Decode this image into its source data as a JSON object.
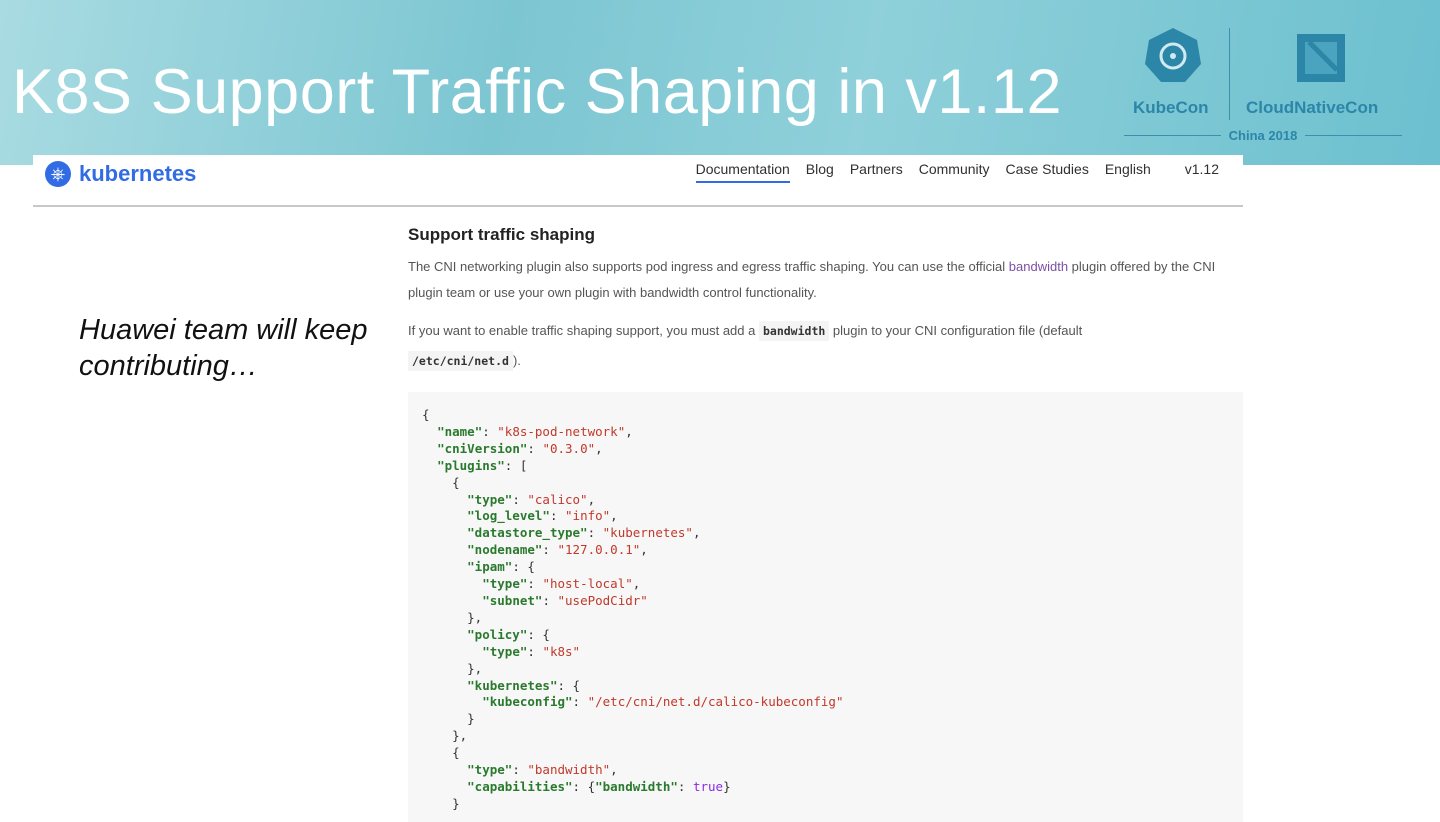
{
  "slide": {
    "title": "K8S Support Traffic Shaping in v1.12",
    "quote_line1": "Huawei team will keep",
    "quote_line2": "contributing…"
  },
  "branding": {
    "kubecon": "KubeCon",
    "cloudnativecon": "CloudNativeCon",
    "event": "China 2018"
  },
  "site": {
    "logo": "kubernetes",
    "nav": [
      "Documentation",
      "Blog",
      "Partners",
      "Community",
      "Case Studies",
      "English",
      "v1.12"
    ],
    "active_nav": "Documentation"
  },
  "article": {
    "heading": "Support traffic shaping",
    "p1_before": "The CNI networking plugin also supports pod ingress and egress traffic shaping. You can use the official ",
    "p1_link": "bandwidth",
    "p1_after": " plugin offered by the CNI plugin team or use your own plugin with bandwidth control functionality.",
    "p2_before": "If you want to enable traffic shaping support, you must add a ",
    "p2_code": "bandwidth",
    "p2_after": " plugin to your CNI configuration file (default",
    "p2_code2": "/etc/cni/net.d",
    "p2_end": ")."
  },
  "code_lines": [
    [
      [
        "p",
        "{"
      ]
    ],
    [
      [
        "p",
        "  "
      ],
      [
        "k",
        "\"name\""
      ],
      [
        "p",
        ": "
      ],
      [
        "s",
        "\"k8s-pod-network\""
      ],
      [
        "p",
        ","
      ]
    ],
    [
      [
        "p",
        "  "
      ],
      [
        "k",
        "\"cniVersion\""
      ],
      [
        "p",
        ": "
      ],
      [
        "s",
        "\"0.3.0\""
      ],
      [
        "p",
        ","
      ]
    ],
    [
      [
        "p",
        "  "
      ],
      [
        "k",
        "\"plugins\""
      ],
      [
        "p",
        ": ["
      ]
    ],
    [
      [
        "p",
        "    {"
      ]
    ],
    [
      [
        "p",
        "      "
      ],
      [
        "k",
        "\"type\""
      ],
      [
        "p",
        ": "
      ],
      [
        "s",
        "\"calico\""
      ],
      [
        "p",
        ","
      ]
    ],
    [
      [
        "p",
        "      "
      ],
      [
        "k",
        "\"log_level\""
      ],
      [
        "p",
        ": "
      ],
      [
        "s",
        "\"info\""
      ],
      [
        "p",
        ","
      ]
    ],
    [
      [
        "p",
        "      "
      ],
      [
        "k",
        "\"datastore_type\""
      ],
      [
        "p",
        ": "
      ],
      [
        "s",
        "\"kubernetes\""
      ],
      [
        "p",
        ","
      ]
    ],
    [
      [
        "p",
        "      "
      ],
      [
        "k",
        "\"nodename\""
      ],
      [
        "p",
        ": "
      ],
      [
        "s",
        "\"127.0.0.1\""
      ],
      [
        "p",
        ","
      ]
    ],
    [
      [
        "p",
        "      "
      ],
      [
        "k",
        "\"ipam\""
      ],
      [
        "p",
        ": {"
      ]
    ],
    [
      [
        "p",
        "        "
      ],
      [
        "k",
        "\"type\""
      ],
      [
        "p",
        ": "
      ],
      [
        "s",
        "\"host-local\""
      ],
      [
        "p",
        ","
      ]
    ],
    [
      [
        "p",
        "        "
      ],
      [
        "k",
        "\"subnet\""
      ],
      [
        "p",
        ": "
      ],
      [
        "s",
        "\"usePodCidr\""
      ]
    ],
    [
      [
        "p",
        "      },"
      ]
    ],
    [
      [
        "p",
        "      "
      ],
      [
        "k",
        "\"policy\""
      ],
      [
        "p",
        ": {"
      ]
    ],
    [
      [
        "p",
        "        "
      ],
      [
        "k",
        "\"type\""
      ],
      [
        "p",
        ": "
      ],
      [
        "s",
        "\"k8s\""
      ]
    ],
    [
      [
        "p",
        "      },"
      ]
    ],
    [
      [
        "p",
        "      "
      ],
      [
        "k",
        "\"kubernetes\""
      ],
      [
        "p",
        ": {"
      ]
    ],
    [
      [
        "p",
        "        "
      ],
      [
        "k",
        "\"kubeconfig\""
      ],
      [
        "p",
        ": "
      ],
      [
        "s",
        "\"/etc/cni/net.d/calico-kubeconfig\""
      ]
    ],
    [
      [
        "p",
        "      }"
      ]
    ],
    [
      [
        "p",
        "    },"
      ]
    ],
    [
      [
        "p",
        "    {"
      ]
    ],
    [
      [
        "p",
        "      "
      ],
      [
        "k",
        "\"type\""
      ],
      [
        "p",
        ": "
      ],
      [
        "s",
        "\"bandwidth\""
      ],
      [
        "p",
        ","
      ]
    ],
    [
      [
        "p",
        "      "
      ],
      [
        "k",
        "\"capabilities\""
      ],
      [
        "p",
        ": {"
      ],
      [
        "k",
        "\"bandwidth\""
      ],
      [
        "p",
        ": "
      ],
      [
        "b",
        "true"
      ],
      [
        "p",
        "}"
      ]
    ],
    [
      [
        "p",
        "    }"
      ]
    ]
  ]
}
